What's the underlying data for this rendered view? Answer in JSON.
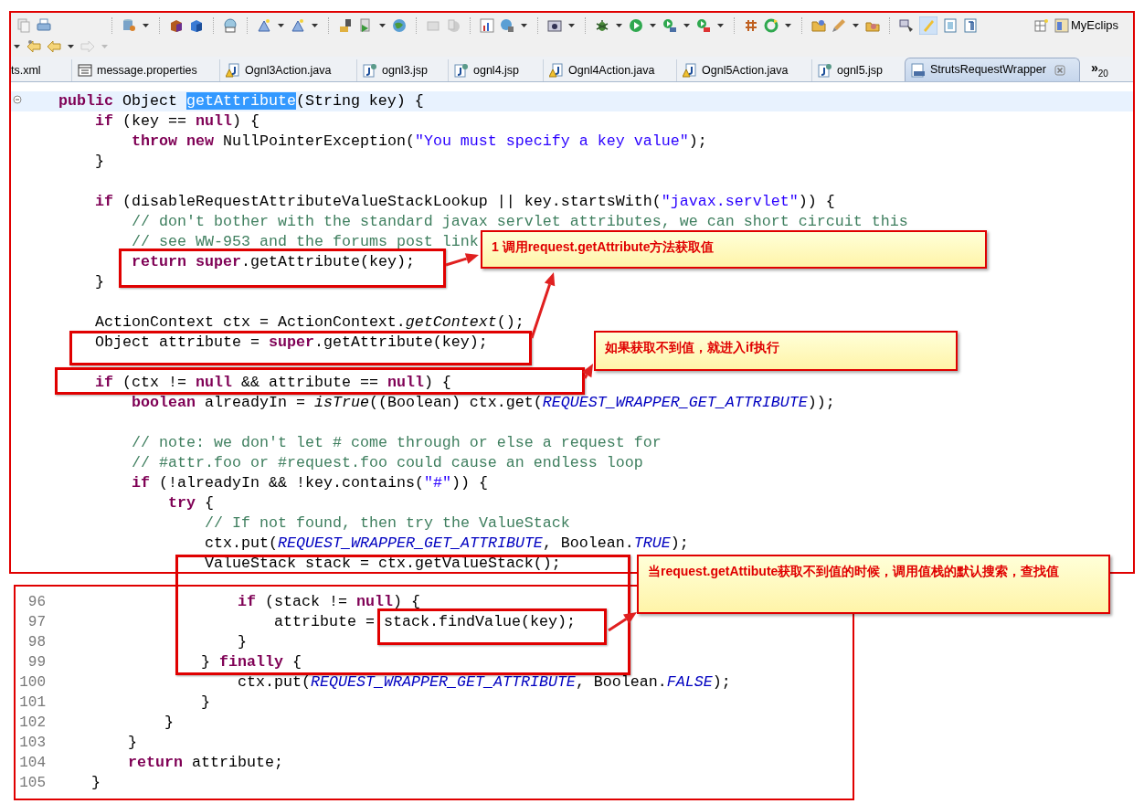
{
  "toolbar": {
    "perspective_label": "MyEclips"
  },
  "tabs": [
    {
      "label": "ts.xml",
      "kind": "partial",
      "selected": false
    },
    {
      "label": "message.properties",
      "kind": "properties",
      "selected": false
    },
    {
      "label": "Ognl3Action.java",
      "kind": "java",
      "selected": false
    },
    {
      "label": "ognl3.jsp",
      "kind": "jsp",
      "selected": false
    },
    {
      "label": "ognl4.jsp",
      "kind": "jsp",
      "selected": false
    },
    {
      "label": "Ognl4Action.java",
      "kind": "java",
      "selected": false
    },
    {
      "label": "Ognl5Action.java",
      "kind": "java",
      "selected": false
    },
    {
      "label": "ognl5.jsp",
      "kind": "jsp",
      "selected": false
    },
    {
      "label": "StrutsRequestWrapper",
      "kind": "class",
      "selected": true
    }
  ],
  "tab_overflow": {
    "glyph": "»",
    "count": "20"
  },
  "editor": {
    "lines": [
      {
        "current": true,
        "segments": [
          {
            "kind": "keyword",
            "text": "    public"
          },
          {
            "kind": "plain",
            "text": " Object "
          },
          {
            "kind": "selection",
            "text": "getAttribute"
          },
          {
            "kind": "plain",
            "text": "(String key) {"
          }
        ]
      },
      {
        "current": false,
        "segments": [
          {
            "kind": "keyword",
            "text": "        if"
          },
          {
            "kind": "plain",
            "text": " (key == "
          },
          {
            "kind": "keyword",
            "text": "null"
          },
          {
            "kind": "plain",
            "text": ") {"
          }
        ]
      },
      {
        "current": false,
        "segments": [
          {
            "kind": "keyword",
            "text": "            throw new"
          },
          {
            "kind": "plain",
            "text": " NullPointerException("
          },
          {
            "kind": "string",
            "text": "\"You must specify a key value\""
          },
          {
            "kind": "plain",
            "text": ");"
          }
        ]
      },
      {
        "current": false,
        "segments": [
          {
            "kind": "plain",
            "text": "        }"
          }
        ]
      },
      {
        "blank": true
      },
      {
        "current": false,
        "segments": [
          {
            "kind": "keyword",
            "text": "        if"
          },
          {
            "kind": "plain",
            "text": " (disableRequestAttributeValueStackLookup || key.startsWith("
          },
          {
            "kind": "string",
            "text": "\"javax.servlet\""
          },
          {
            "kind": "plain",
            "text": ")) {"
          }
        ]
      },
      {
        "current": false,
        "segments": [
          {
            "kind": "comment",
            "text": "            // don't bother with the standard javax servlet attributes, we can short circuit this"
          }
        ]
      },
      {
        "current": false,
        "segments": [
          {
            "kind": "comment",
            "text": "            // see WW-953 and the forums post link"
          }
        ]
      },
      {
        "current": false,
        "segments": [
          {
            "kind": "keyword",
            "text": "            return super"
          },
          {
            "kind": "plain",
            "text": ".getAttribute(key);"
          }
        ]
      },
      {
        "current": false,
        "segments": [
          {
            "kind": "plain",
            "text": "        }"
          }
        ]
      },
      {
        "blank": true
      },
      {
        "current": false,
        "segments": [
          {
            "kind": "plain",
            "text": "        ActionContext ctx = ActionContext."
          },
          {
            "kind": "static",
            "text": "getContext"
          },
          {
            "kind": "plain",
            "text": "();"
          }
        ]
      },
      {
        "current": false,
        "segments": [
          {
            "kind": "plain",
            "text": "        Object attribute = "
          },
          {
            "kind": "keyword",
            "text": "super"
          },
          {
            "kind": "plain",
            "text": ".getAttribute(key);"
          }
        ]
      },
      {
        "blank": true
      },
      {
        "current": false,
        "segments": [
          {
            "kind": "keyword",
            "text": "        if"
          },
          {
            "kind": "plain",
            "text": " (ctx != "
          },
          {
            "kind": "keyword",
            "text": "null"
          },
          {
            "kind": "plain",
            "text": " && attribute == "
          },
          {
            "kind": "keyword",
            "text": "null"
          },
          {
            "kind": "plain",
            "text": ") {"
          }
        ]
      },
      {
        "current": false,
        "segments": [
          {
            "kind": "keyword",
            "text": "            boolean"
          },
          {
            "kind": "plain",
            "text": " alreadyIn = "
          },
          {
            "kind": "static",
            "text": "isTrue"
          },
          {
            "kind": "plain",
            "text": "((Boolean) ctx.get("
          },
          {
            "kind": "field",
            "text": "REQUEST_WRAPPER_GET_ATTRIBUTE"
          },
          {
            "kind": "plain",
            "text": "));"
          }
        ]
      },
      {
        "blank": true
      },
      {
        "current": false,
        "segments": [
          {
            "kind": "comment",
            "text": "            // note: we don't let # come through or else a request for"
          }
        ]
      },
      {
        "current": false,
        "segments": [
          {
            "kind": "comment",
            "text": "            // #attr.foo or #request.foo could cause an endless loop"
          }
        ]
      },
      {
        "current": false,
        "segments": [
          {
            "kind": "keyword",
            "text": "            if"
          },
          {
            "kind": "plain",
            "text": " (!alreadyIn && !key.contains("
          },
          {
            "kind": "string",
            "text": "\"#\""
          },
          {
            "kind": "plain",
            "text": ")) {"
          }
        ]
      },
      {
        "current": false,
        "segments": [
          {
            "kind": "keyword",
            "text": "                try"
          },
          {
            "kind": "plain",
            "text": " {"
          }
        ]
      },
      {
        "current": false,
        "segments": [
          {
            "kind": "comment",
            "text": "                    // If not found, then try the ValueStack"
          }
        ]
      },
      {
        "current": false,
        "segments": [
          {
            "kind": "plain",
            "text": "                    ctx.put("
          },
          {
            "kind": "field",
            "text": "REQUEST_WRAPPER_GET_ATTRIBUTE"
          },
          {
            "kind": "plain",
            "text": ", Boolean."
          },
          {
            "kind": "field",
            "text": "TRUE"
          },
          {
            "kind": "plain",
            "text": ");"
          }
        ]
      },
      {
        "current": false,
        "segments": [
          {
            "kind": "plain",
            "text": "                    ValueStack stack = ctx.getValueStack();"
          }
        ]
      }
    ]
  },
  "lower_editor": {
    "lines": [
      {
        "number": "96",
        "segments": [
          {
            "kind": "keyword",
            "text": "                    if"
          },
          {
            "kind": "plain",
            "text": " (stack != "
          },
          {
            "kind": "keyword",
            "text": "null"
          },
          {
            "kind": "plain",
            "text": ") {"
          }
        ]
      },
      {
        "number": "97",
        "segments": [
          {
            "kind": "plain",
            "text": "                        attribute = stack.findValue(key);"
          }
        ]
      },
      {
        "number": "98",
        "segments": [
          {
            "kind": "plain",
            "text": "                    }"
          }
        ]
      },
      {
        "number": "99",
        "segments": [
          {
            "kind": "plain",
            "text": "                } "
          },
          {
            "kind": "keyword",
            "text": "finally"
          },
          {
            "kind": "plain",
            "text": " {"
          }
        ]
      },
      {
        "number": "100",
        "segments": [
          {
            "kind": "plain",
            "text": "                    ctx.put("
          },
          {
            "kind": "field",
            "text": "REQUEST_WRAPPER_GET_ATTRIBUTE"
          },
          {
            "kind": "plain",
            "text": ", Boolean."
          },
          {
            "kind": "field",
            "text": "FALSE"
          },
          {
            "kind": "plain",
            "text": ");"
          }
        ]
      },
      {
        "number": "101",
        "segments": [
          {
            "kind": "plain",
            "text": "                }"
          }
        ]
      },
      {
        "number": "102",
        "segments": [
          {
            "kind": "plain",
            "text": "            }"
          }
        ]
      },
      {
        "number": "103",
        "segments": [
          {
            "kind": "plain",
            "text": "        }"
          }
        ]
      },
      {
        "number": "104",
        "segments": [
          {
            "kind": "keyword",
            "text": "        return"
          },
          {
            "kind": "plain",
            "text": " attribute;"
          }
        ]
      },
      {
        "number": "105",
        "segments": [
          {
            "kind": "plain",
            "text": "    }"
          }
        ]
      }
    ]
  },
  "callouts": [
    {
      "text": "1 调用request.getAttribute方法获取值"
    },
    {
      "text": "如果获取不到值，就进入if执行"
    },
    {
      "text": "当request.getAttibute获取不到值的时候，调用值栈的默认搜索，查找值"
    }
  ]
}
